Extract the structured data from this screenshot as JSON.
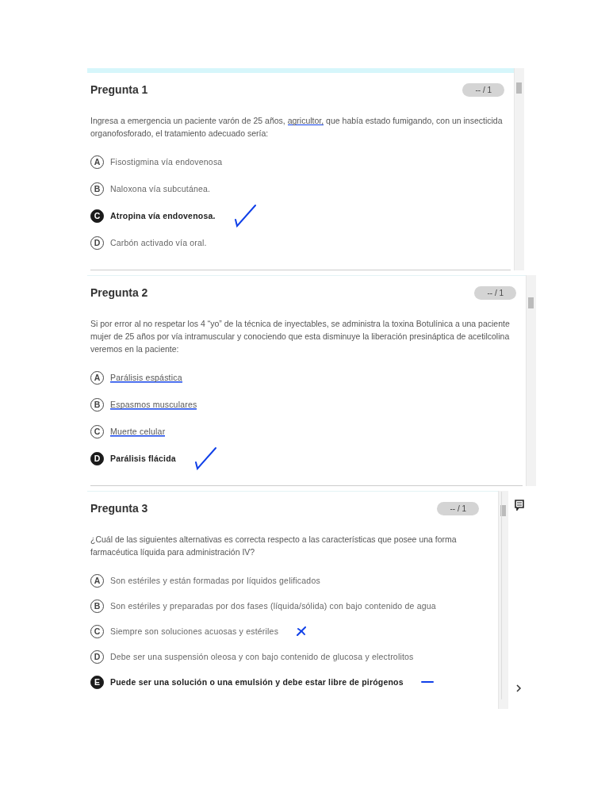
{
  "questions": [
    {
      "title": "Pregunta 1",
      "score": "-- / 1",
      "text_parts": [
        {
          "text": "Ingresa a emergencia un paciente varón de 25 años, ",
          "underlined": false
        },
        {
          "text": "agricultor,",
          "underlined": true
        },
        {
          "text": " que había estado fumigando, con un insecticida organofosforado, el tratamiento adecuado sería:",
          "underlined": false
        }
      ],
      "options": [
        {
          "letter": "A",
          "text": "Fisostigmina vía endovenosa",
          "selected": false,
          "struck": false
        },
        {
          "letter": "B",
          "text": "Naloxona vía subcutánea.",
          "selected": false,
          "struck": false
        },
        {
          "letter": "C",
          "text": "Atropina vía endovenosa.",
          "selected": true,
          "struck": false,
          "annotation": {
            "kind": "check"
          }
        },
        {
          "letter": "D",
          "text": "Carbón activado vía oral.",
          "selected": false,
          "struck": false
        }
      ]
    },
    {
      "title": "Pregunta 2",
      "score": "-- / 1",
      "text_parts": [
        {
          "text": "Si por error al no respetar los 4 “yo” de la técnica de inyectables, se administra la toxina Botulínica a una paciente mujer de 25 años por vía intramuscular y conociendo que esta disminuye la liberación presináptica de acetilcolina veremos en la paciente:",
          "underlined": false
        }
      ],
      "options": [
        {
          "letter": "A",
          "text": "Parálisis espástica",
          "selected": false,
          "struck": true
        },
        {
          "letter": "B",
          "text": "Espasmos musculares",
          "selected": false,
          "struck": true
        },
        {
          "letter": "C",
          "text": "Muerte celular",
          "selected": false,
          "struck": true
        },
        {
          "letter": "D",
          "text": "Parálisis flácida",
          "selected": true,
          "struck": false,
          "annotation": {
            "kind": "check"
          }
        }
      ]
    },
    {
      "title": "Pregunta 3",
      "score": "-- / 1",
      "text_parts": [
        {
          "text": "¿Cuál de las siguientes alternativas es correcta respecto a las características que posee una forma farmacéutica líquida para administración IV?",
          "underlined": false
        }
      ],
      "options": [
        {
          "letter": "A",
          "text": "Son estériles y están formadas por líquidos gelificados",
          "selected": false,
          "struck": false
        },
        {
          "letter": "B",
          "text": "Son estériles y preparadas por dos fases (líquida/sólida) con bajo contenido de agua",
          "selected": false,
          "struck": false
        },
        {
          "letter": "C",
          "text": "Siempre son soluciones acuosas y estériles",
          "selected": false,
          "struck": false,
          "annotation": {
            "kind": "cross"
          }
        },
        {
          "letter": "D",
          "text": "Debe ser una suspensión oleosa y con bajo contenido de glucosa y electrolitos",
          "selected": false,
          "struck": false
        },
        {
          "letter": "E",
          "text": "Puede ser una solución o una emulsión y debe estar libre de pirógenos",
          "selected": true,
          "struck": false,
          "annotation": {
            "kind": "dash"
          }
        }
      ]
    }
  ]
}
